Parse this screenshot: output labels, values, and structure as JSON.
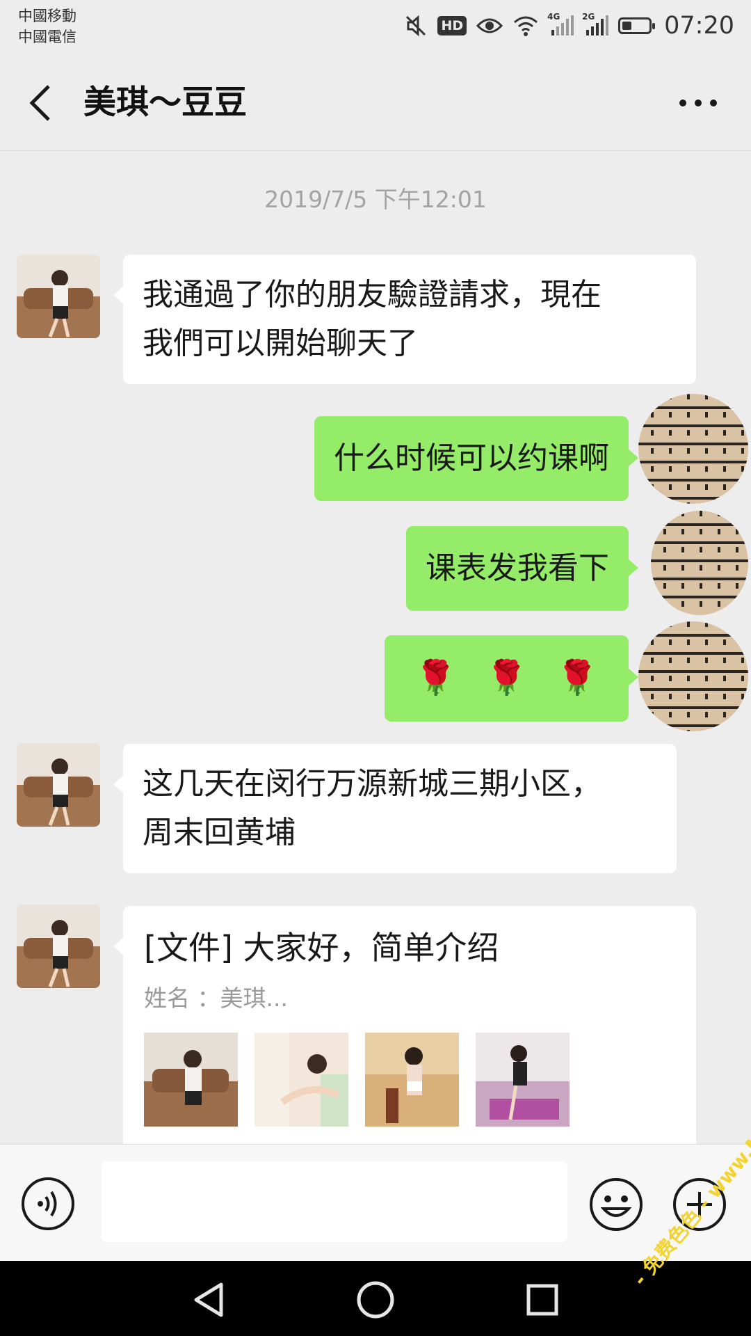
{
  "status_bar": {
    "carrier_1": "中國移動",
    "carrier_2": "中國電信",
    "hd_label": "HD",
    "net_1": "4G",
    "net_2": "2G",
    "battery_level": 0.35,
    "time": "07:20",
    "icons": [
      "mute-icon",
      "hd-icon",
      "eye-icon",
      "wifi-icon",
      "signal-4g-icon",
      "signal-2g-icon",
      "battery-icon"
    ]
  },
  "header": {
    "back_icon": "chevron-left-icon",
    "title": "美琪～豆豆",
    "more_icon": "more-dots-icon"
  },
  "timestamp": "2019/7/5 下午12:01",
  "messages": [
    {
      "side": "in",
      "line1": "我通過了你的朋友驗證請求，現在",
      "line2": "我們可以開始聊天了"
    },
    {
      "side": "out",
      "text": "什么时候可以约课啊"
    },
    {
      "side": "out",
      "text": "课表发我看下"
    },
    {
      "side": "out",
      "emoji": [
        "🌹",
        "🌹",
        "🌹"
      ]
    },
    {
      "side": "in",
      "line1": "这几天在闵行万源新城三期小区，",
      "line2": "周末回黄埔"
    }
  ],
  "file_card": {
    "title": "[文件] 大家好，简单介绍",
    "subtitle": "姓名 ：美琪...",
    "thumbnail_count": 4
  },
  "input_bar": {
    "voice_icon": "voice-input-icon",
    "text_value": "",
    "emoji_icon": "emoji-smiley-icon",
    "plus_icon": "plus-circle-icon"
  },
  "nav_bar": {
    "icons": [
      "nav-back-icon",
      "nav-home-icon",
      "nav-recents-icon"
    ]
  },
  "watermark": "- 免费色色 -  www.MFsese.com",
  "colors": {
    "background": "#ededed",
    "incoming_bubble": "#ffffff",
    "outgoing_bubble": "#95ec69",
    "timestamp_text": "#a3a3a3",
    "watermark": "#f3d330"
  }
}
